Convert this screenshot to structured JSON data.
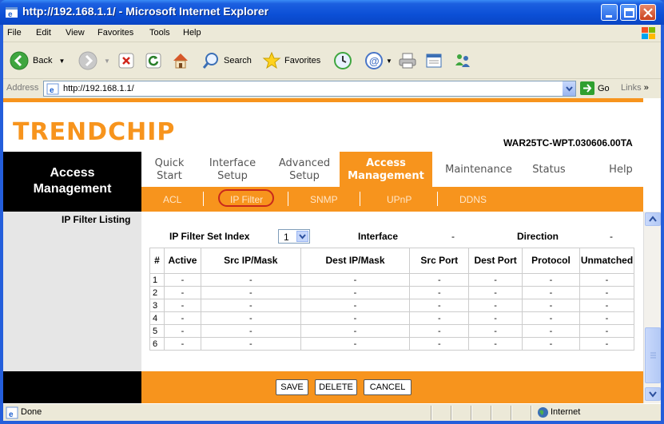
{
  "window": {
    "title": "http://192.168.1.1/ - Microsoft Internet Explorer"
  },
  "menu": [
    "File",
    "Edit",
    "View",
    "Favorites",
    "Tools",
    "Help"
  ],
  "toolbar": {
    "back": "Back",
    "search": "Search",
    "favorites": "Favorites"
  },
  "address": {
    "label": "Address",
    "url": "http://192.168.1.1/",
    "go": "Go",
    "links": "Links"
  },
  "header": {
    "logo": "TRENDCHIP",
    "model": "WAR25TC-WPT.030606.00TA"
  },
  "sidebar": {
    "title_line1": "Access",
    "title_line2": "Management",
    "section": "IP Filter Listing"
  },
  "nav": {
    "quick_l1": "Quick",
    "quick_l2": "Start",
    "iface_l1": "Interface",
    "iface_l2": "Setup",
    "adv_l1": "Advanced",
    "adv_l2": "Setup",
    "access_l1": "Access",
    "access_l2": "Management",
    "maintenance": "Maintenance",
    "status": "Status",
    "help": "Help"
  },
  "subnav": [
    "ACL",
    "IP Filter",
    "SNMP",
    "UPnP",
    "DDNS"
  ],
  "filter": {
    "set_index_label": "IP Filter Set Index",
    "set_index_value": "1",
    "interface_label": "Interface",
    "interface_value": "-",
    "direction_label": "Direction",
    "direction_value": "-"
  },
  "table": {
    "headers": [
      "#",
      "Active",
      "Src IP/Mask",
      "Dest IP/Mask",
      "Src Port",
      "Dest Port",
      "Protocol",
      "Unmatched"
    ],
    "rows": [
      [
        "1",
        "-",
        "-",
        "-",
        "-",
        "-",
        "-",
        "-"
      ],
      [
        "2",
        "-",
        "-",
        "-",
        "-",
        "-",
        "-",
        "-"
      ],
      [
        "3",
        "-",
        "-",
        "-",
        "-",
        "-",
        "-",
        "-"
      ],
      [
        "4",
        "-",
        "-",
        "-",
        "-",
        "-",
        "-",
        "-"
      ],
      [
        "5",
        "-",
        "-",
        "-",
        "-",
        "-",
        "-",
        "-"
      ],
      [
        "6",
        "-",
        "-",
        "-",
        "-",
        "-",
        "-",
        "-"
      ]
    ]
  },
  "buttons": {
    "save": "SAVE",
    "delete": "DELETE",
    "cancel": "CANCEL"
  },
  "status": {
    "left": "Done",
    "zone": "Internet"
  },
  "colors": {
    "accent": "#f7941d",
    "title_bar": "#0b4fd6",
    "chrome": "#ece9d8"
  }
}
